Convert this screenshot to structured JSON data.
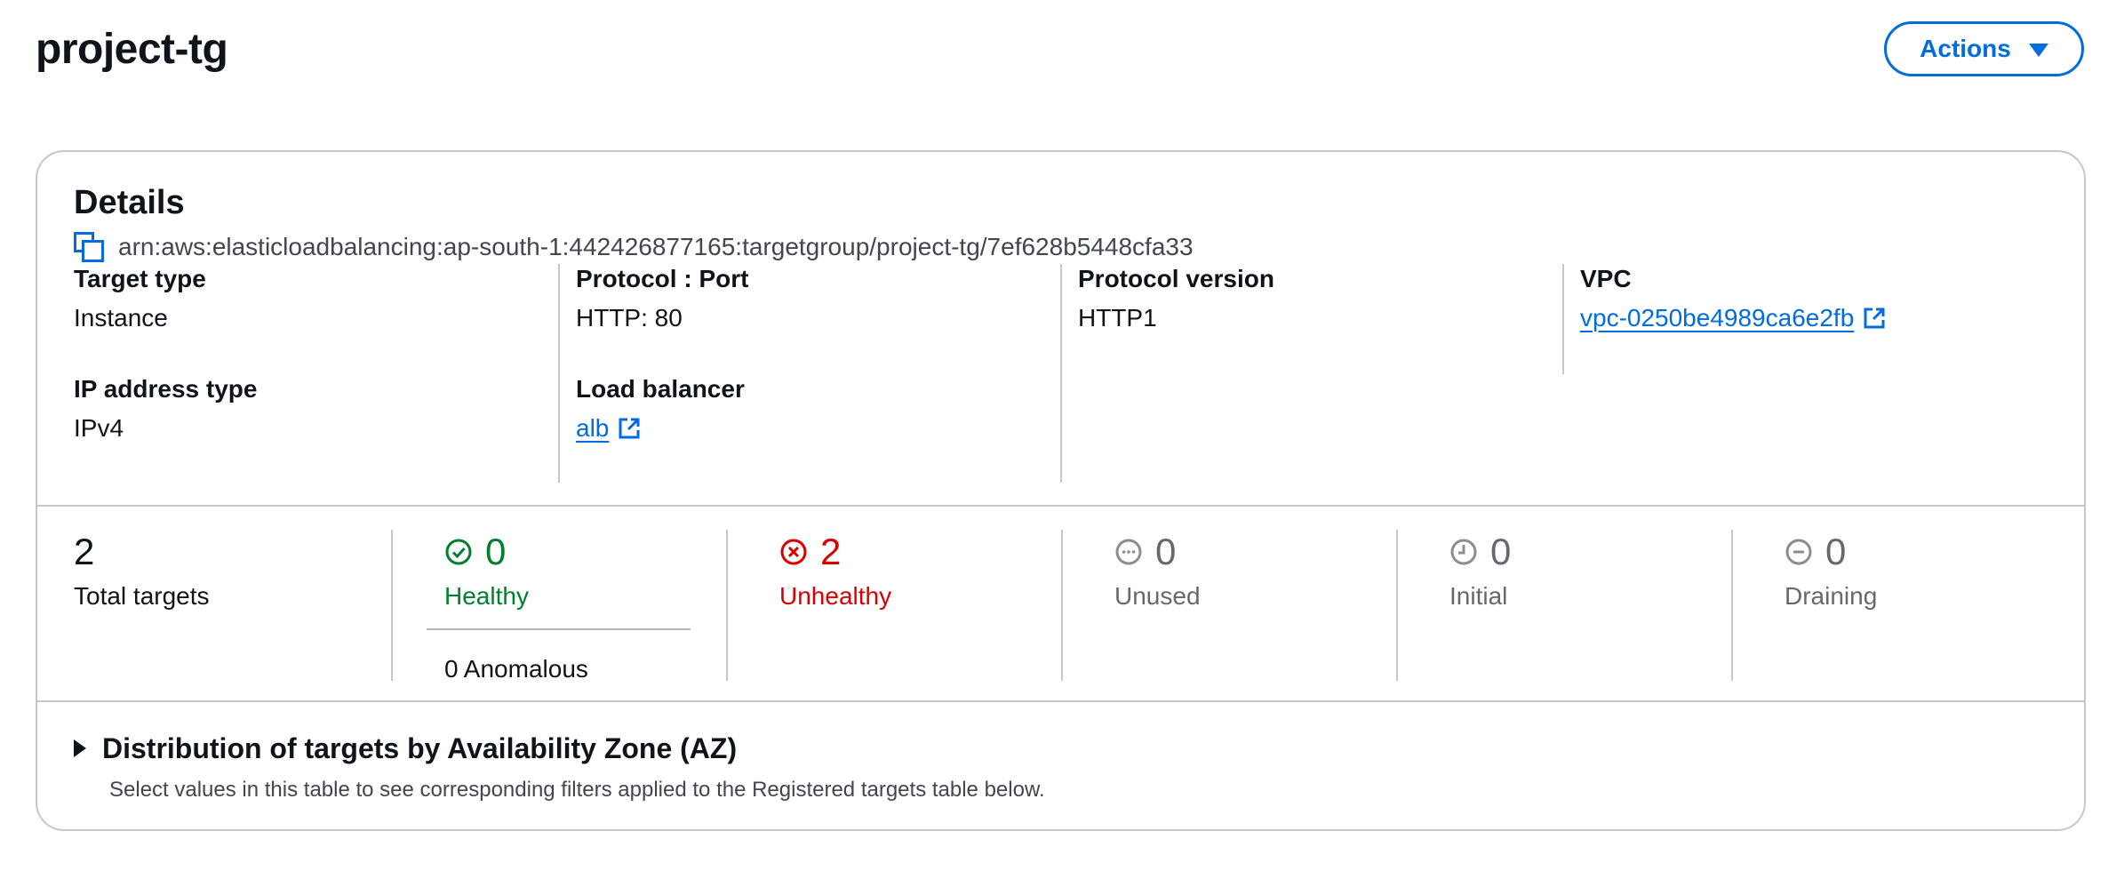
{
  "header": {
    "title": "project-tg",
    "actions_label": "Actions"
  },
  "details": {
    "title": "Details",
    "arn": "arn:aws:elasticloadbalancing:ap-south-1:442426877165:targetgroup/project-tg/7ef628b5448cfa33",
    "fields": {
      "target_type": {
        "label": "Target type",
        "value": "Instance"
      },
      "ip_address_type": {
        "label": "IP address type",
        "value": "IPv4"
      },
      "protocol_port": {
        "label": "Protocol : Port",
        "value": "HTTP: 80"
      },
      "load_balancer": {
        "label": "Load balancer",
        "value": "alb"
      },
      "protocol_version": {
        "label": "Protocol version",
        "value": "HTTP1"
      },
      "vpc": {
        "label": "VPC",
        "value": "vpc-0250be4989ca6e2fb"
      }
    }
  },
  "stats": {
    "total": {
      "value": "2",
      "label": "Total targets"
    },
    "healthy": {
      "value": "0",
      "label": "Healthy",
      "anomalous": "0 Anomalous"
    },
    "unhealthy": {
      "value": "2",
      "label": "Unhealthy"
    },
    "unused": {
      "value": "0",
      "label": "Unused"
    },
    "initial": {
      "value": "0",
      "label": "Initial"
    },
    "draining": {
      "value": "0",
      "label": "Draining"
    }
  },
  "az_distribution": {
    "title": "Distribution of targets by Availability Zone (AZ)",
    "description": "Select values in this table to see corresponding filters applied to the Registered targets table below.",
    "expanded": false
  },
  "colors": {
    "accent": "#006ce0",
    "healthy": "#00802f",
    "unhealthy": "#db0000",
    "neutral": "#656871",
    "border": "#c6c6cd"
  }
}
